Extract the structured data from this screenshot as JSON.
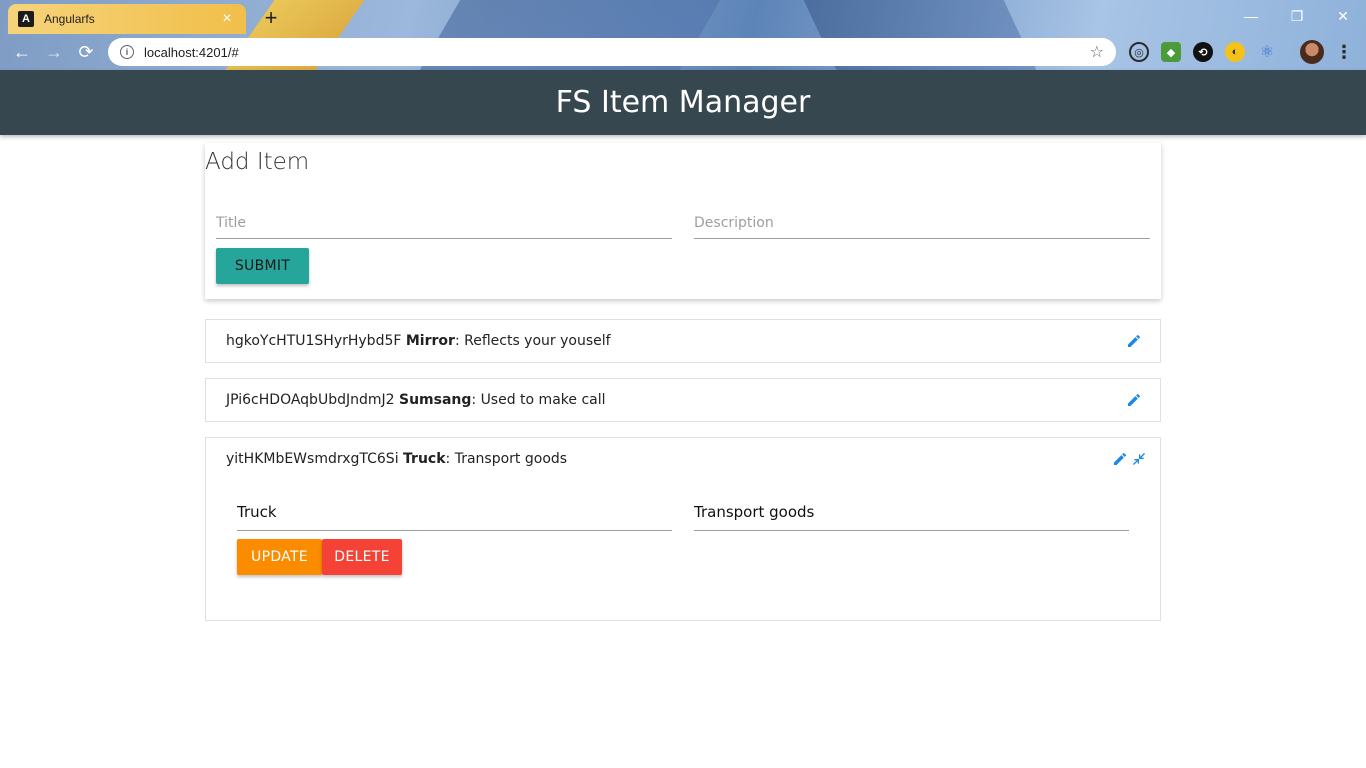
{
  "browser": {
    "tab_title": "Angularfs",
    "tab_favicon": "A",
    "tab_close": "×",
    "new_tab": "+",
    "url": "localhost:4201/#",
    "window_controls": {
      "minimize": "—",
      "maximize": "❐",
      "close": "✕"
    },
    "nav": {
      "back": "←",
      "forward": "→",
      "reload": "⟳"
    },
    "star": "☆",
    "menu": "⋮",
    "extensions": [
      "circle-ext-icon",
      "green-ext-icon",
      "sync-ext-icon",
      "yellow-ext-icon",
      "react-ext-icon"
    ]
  },
  "app": {
    "title": "FS Item Manager",
    "header_color": "#37474f"
  },
  "add_item": {
    "heading": "Add Item",
    "title_placeholder": "Title",
    "description_placeholder": "Description",
    "submit_label": "SUBMIT",
    "submit_color": "#26a69a"
  },
  "items": [
    {
      "id": "hgkoYcHTU1SHyrHybd5F",
      "title": "Mirror",
      "description": "Reflects your youself"
    },
    {
      "id": "JPi6cHDOAqbUbdJndmJ2",
      "title": "Sumsang",
      "description": "Used to make call"
    },
    {
      "id": "yitHKMbEWsmdrxgTC6Si",
      "title": "Truck",
      "description": "Transport goods"
    }
  ],
  "edit_form": {
    "title_value": "Truck",
    "description_value": "Transport goods",
    "update_label": "UPDATE",
    "delete_label": "DELETE",
    "update_color": "#fb8c00",
    "delete_color": "#f44336"
  },
  "colors": {
    "accent": "#1e88e5"
  }
}
